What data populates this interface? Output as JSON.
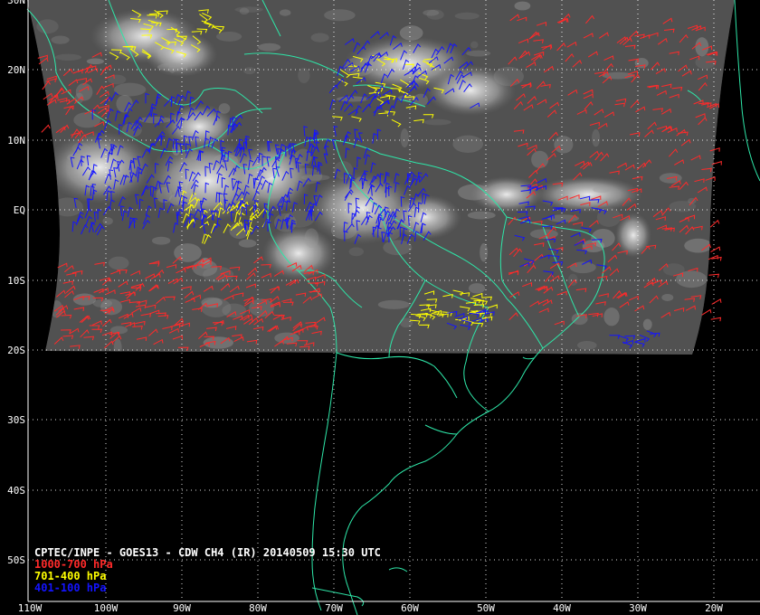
{
  "product": {
    "title": "CPTEC/INPE - GOES13 - CDW CH4 (IR) 20140509 15:30 UTC"
  },
  "legend": [
    {
      "label": "1000-700 hPa",
      "color": "#ff2a2a"
    },
    {
      "label": "701-400 hPa",
      "color": "#ffff00"
    },
    {
      "label": "401-100 hPa",
      "color": "#1414ff"
    }
  ],
  "axes": {
    "lat_labels": [
      "30N",
      "20N",
      "10N",
      "EQ",
      "10S",
      "20S",
      "30S",
      "40S",
      "50S"
    ],
    "lon_labels": [
      "110W",
      "100W",
      "90W",
      "80W",
      "70W",
      "60W",
      "50W",
      "40W",
      "30W",
      "20W"
    ]
  },
  "colors": {
    "coastline": "#2ee6a8",
    "grid": "#ffffff",
    "background": "#000000"
  }
}
